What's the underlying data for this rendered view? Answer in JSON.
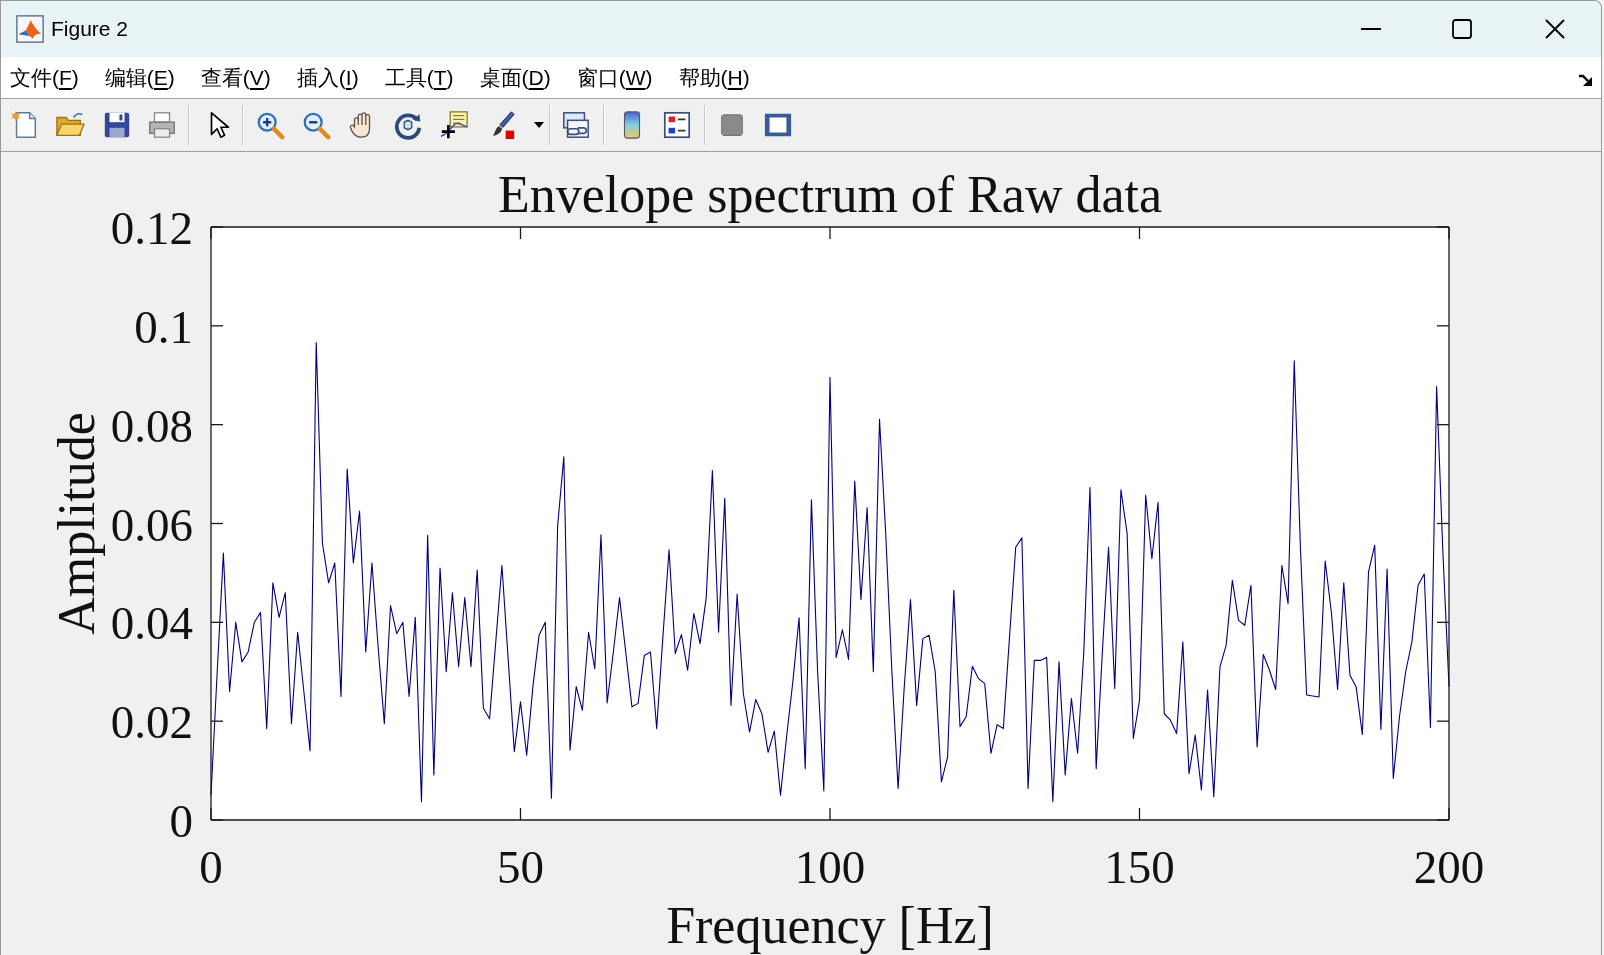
{
  "window": {
    "title": "Figure 2"
  },
  "menu_bar": [
    "文件(F)",
    "编辑(E)",
    "查看(V)",
    "插入(I)",
    "工具(T)",
    "桌面(D)",
    "窗口(W)",
    "帮助(H)"
  ],
  "figure": {
    "chart_data": {
      "type": "line",
      "title": "Envelope spectrum of Raw data",
      "xlabel": "Frequency [Hz]",
      "ylabel": "Amplitude",
      "x": [
        0,
        1,
        2,
        3,
        4,
        5,
        6,
        7,
        8,
        9,
        10,
        11,
        12,
        13,
        14,
        15,
        16,
        17,
        18,
        19,
        20,
        21,
        22,
        23,
        24,
        25,
        26,
        27,
        28,
        29,
        30,
        31,
        32,
        33,
        34,
        35,
        36,
        37,
        38,
        39,
        40,
        41,
        42,
        43,
        44,
        45,
        46,
        47,
        48,
        49,
        50,
        51,
        52,
        53,
        54,
        55,
        56,
        57,
        58,
        59,
        60,
        61,
        62,
        63,
        64,
        65,
        66,
        67,
        68,
        69,
        70,
        71,
        72,
        73,
        74,
        75,
        76,
        77,
        78,
        79,
        80,
        81,
        82,
        83,
        84,
        85,
        86,
        87,
        88,
        89,
        90,
        91,
        92,
        93,
        94,
        95,
        96,
        97,
        98,
        99,
        100,
        101,
        102,
        103,
        104,
        105,
        106,
        107,
        108,
        109,
        110,
        111,
        112,
        113,
        114,
        115,
        116,
        117,
        118,
        119,
        120,
        121,
        122,
        123,
        124,
        125,
        126,
        127,
        128,
        129,
        130,
        131,
        132,
        133,
        134,
        135,
        136,
        137,
        138,
        139,
        140,
        141,
        142,
        143,
        144,
        145,
        146,
        147,
        148,
        149,
        150,
        151,
        152,
        153,
        154,
        155,
        156,
        157,
        158,
        159,
        160,
        161,
        162,
        163,
        164,
        165,
        166,
        167,
        168,
        169,
        170,
        171,
        172,
        173,
        174,
        175,
        176,
        177,
        178,
        179,
        180,
        181,
        182,
        183,
        184,
        185,
        186,
        187,
        188,
        189,
        190,
        191,
        192,
        193,
        194,
        195,
        196,
        197,
        198,
        199,
        200
      ],
      "series": [
        {
          "color": "#000080",
          "values": [
            0.005,
            0.03,
            0.054,
            0.026,
            0.04,
            0.032,
            0.034,
            0.04,
            0.042,
            0.0185,
            0.048,
            0.041,
            0.046,
            0.0195,
            0.038,
            0.026,
            0.014,
            0.0966,
            0.056,
            0.048,
            0.052,
            0.025,
            0.071,
            0.052,
            0.0625,
            0.034,
            0.052,
            0.035,
            0.0195,
            0.0434,
            0.0377,
            0.04,
            0.025,
            0.041,
            0.0037,
            0.0576,
            0.0091,
            0.051,
            0.03,
            0.046,
            0.031,
            0.045,
            0.031,
            0.0506,
            0.0226,
            0.0205,
            0.036,
            0.0515,
            0.0327,
            0.0138,
            0.0239,
            0.0131,
            0.027,
            0.0374,
            0.04,
            0.0044,
            0.0596,
            0.0735,
            0.0141,
            0.027,
            0.0222,
            0.038,
            0.0306,
            0.0577,
            0.0237,
            0.034,
            0.045,
            0.034,
            0.0229,
            0.0236,
            0.0333,
            0.034,
            0.0185,
            0.037,
            0.0547,
            0.0337,
            0.0375,
            0.0303,
            0.0418,
            0.0357,
            0.045,
            0.0707,
            0.038,
            0.0651,
            0.0232,
            0.0457,
            0.0256,
            0.0178,
            0.0244,
            0.0215,
            0.0137,
            0.018,
            0.005,
            0.017,
            0.028,
            0.0409,
            0.0104,
            0.0648,
            0.03,
            0.0059,
            0.0896,
            0.0329,
            0.0385,
            0.0325,
            0.0686,
            0.0446,
            0.0632,
            0.03,
            0.0811,
            0.058,
            0.03,
            0.0064,
            0.027,
            0.0446,
            0.0232,
            0.0367,
            0.0374,
            0.03,
            0.0077,
            0.0128,
            0.0465,
            0.0189,
            0.0209,
            0.0311,
            0.0286,
            0.0276,
            0.0135,
            0.0193,
            0.0185,
            0.037,
            0.0552,
            0.0571,
            0.0064,
            0.0323,
            0.0323,
            0.0329,
            0.0037,
            0.032,
            0.0091,
            0.0246,
            0.0135,
            0.034,
            0.0673,
            0.0104,
            0.034,
            0.0552,
            0.0266,
            0.0668,
            0.058,
            0.0165,
            0.0242,
            0.0657,
            0.0529,
            0.0643,
            0.0215,
            0.0202,
            0.0175,
            0.036,
            0.0094,
            0.0172,
            0.0061,
            0.0263,
            0.0047,
            0.031,
            0.0354,
            0.0485,
            0.0404,
            0.0394,
            0.0475,
            0.0148,
            0.0335,
            0.0303,
            0.0264,
            0.0515,
            0.0438,
            0.0929,
            0.055,
            0.0253,
            0.0251,
            0.0249,
            0.0524,
            0.042,
            0.0264,
            0.048,
            0.0293,
            0.0269,
            0.0173,
            0.0502,
            0.0556,
            0.0183,
            0.0508,
            0.0084,
            0.0209,
            0.03,
            0.036,
            0.0475,
            0.0498,
            0.0187,
            0.0877,
            0.0545,
            0.027
          ]
        }
      ],
      "xlim": [
        0,
        200
      ],
      "ylim": [
        0,
        0.12
      ],
      "xticks": [
        0,
        50,
        100,
        150,
        200
      ],
      "yticks": [
        0,
        0.02,
        0.04,
        0.06,
        0.08,
        0.1,
        0.12
      ]
    }
  }
}
